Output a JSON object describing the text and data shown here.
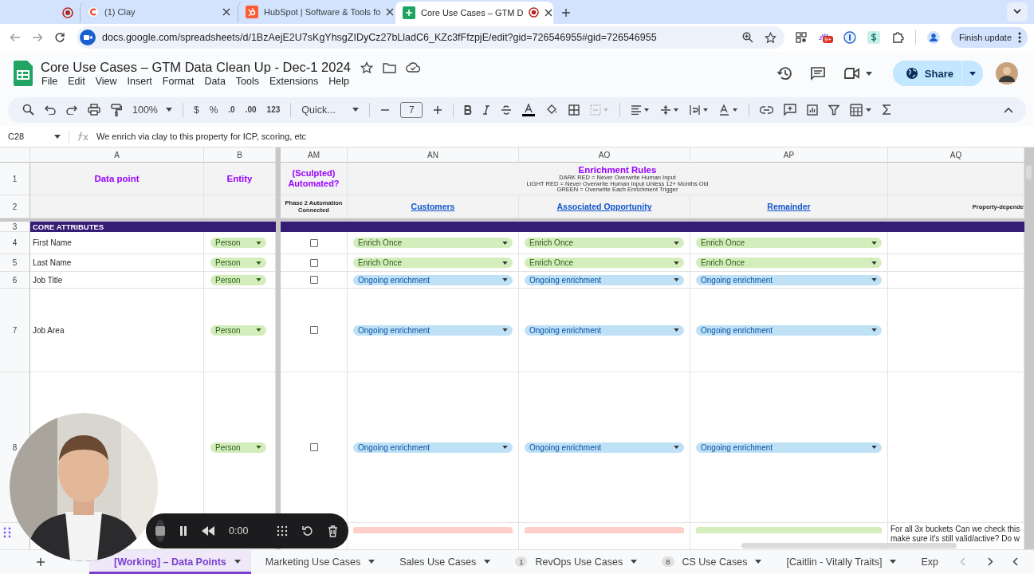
{
  "browser": {
    "tabs": [
      {
        "kind": "pinned",
        "selected": false
      },
      {
        "kind": "clay",
        "title": "(1) Clay",
        "selected": false
      },
      {
        "kind": "hubspot",
        "title": "HubSpot | Software & Tools fo",
        "selected": false
      },
      {
        "kind": "sheets",
        "title": "Core Use Cases – GTM D",
        "selected": true
      }
    ],
    "url": "docs.google.com/spreadsheets/d/1BzAejE2U7sKgYhsgZIDyCz27bLladC6_KZc3fFfzpjE/edit?gid=726546955#gid=726546955",
    "extension_badge": "9+",
    "finish_update": "Finish update"
  },
  "doc": {
    "title": "Core Use Cases – GTM Data Clean Up - Dec-1 2024",
    "menus": [
      "File",
      "Edit",
      "View",
      "Insert",
      "Format",
      "Data",
      "Tools",
      "Extensions",
      "Help"
    ],
    "share": "Share"
  },
  "toolbar": {
    "zoom": "100%",
    "currency": "$",
    "percent": "%",
    "decrease_decimal": ".0",
    "increase_decimal": ".00",
    "number_format": "123",
    "font": "Quick...",
    "font_size": "7"
  },
  "formula_bar": {
    "cell": "C28",
    "formula": "We enrich via clay to this property for ICP, scoring, etc"
  },
  "sheet": {
    "columns": [
      "A",
      "B",
      "AM",
      "AN",
      "AO",
      "AP",
      "AQ"
    ],
    "header_row": {
      "number": "1",
      "a": "Data point",
      "b": "Entity",
      "am": "(Sculpted) Automated?",
      "rules_title": "Enrichment Rules",
      "rules_lines": [
        "DARK RED = Never Overwrite Human Input",
        "LIGHT RED = Never Overwrite Human Input Unless 12+ Months Old",
        "GREEN = Overwrite Each Enrichment Trigger"
      ]
    },
    "sub_header_row": {
      "number": "2",
      "am": "Phase 2 Automation Connected",
      "links": [
        "Customers",
        "Associated Opportunity",
        "Remainder"
      ],
      "aq": "Property-depende"
    },
    "section_row": {
      "number": "3",
      "label": "CORE ATTRIBUTES"
    },
    "rows": [
      {
        "number": "4",
        "name": "First Name",
        "entity": {
          "label": "Person",
          "color": "#d4edbc"
        },
        "checked": false,
        "chips": [
          {
            "label": "Enrich Once",
            "color": "#d4edbc"
          },
          {
            "label": "Enrich Once",
            "color": "#d4edbc"
          },
          {
            "label": "Enrich Once",
            "color": "#d4edbc"
          }
        ]
      },
      {
        "number": "5",
        "name": "Last Name",
        "entity": {
          "label": "Person",
          "color": "#d4edbc"
        },
        "checked": false,
        "chips": [
          {
            "label": "Enrich Once",
            "color": "#d4edbc"
          },
          {
            "label": "Enrich Once",
            "color": "#d4edbc"
          },
          {
            "label": "Enrich Once",
            "color": "#d4edbc"
          }
        ]
      },
      {
        "number": "6",
        "name": "Job Title",
        "entity": {
          "label": "Person",
          "color": "#d4edbc"
        },
        "checked": false,
        "chips": [
          {
            "label": "Ongoing enrichment",
            "color": "#bfe1f6"
          },
          {
            "label": "Ongoing enrichment",
            "color": "#bfe1f6"
          },
          {
            "label": "Ongoing enrichment",
            "color": "#bfe1f6"
          }
        ]
      },
      {
        "number": "7",
        "name": "Job Area",
        "entity": {
          "label": "Person",
          "color": "#d4edbc"
        },
        "checked": false,
        "chips": [
          {
            "label": "Ongoing enrichment",
            "color": "#bfe1f6"
          },
          {
            "label": "Ongoing enrichment",
            "color": "#bfe1f6"
          },
          {
            "label": "Ongoing enrichment",
            "color": "#bfe1f6"
          }
        ]
      },
      {
        "number": "8",
        "entity": {
          "label": "Person",
          "color": "#d4edbc"
        },
        "checked": false,
        "chips": [
          {
            "label": "Ongoing enrichment",
            "color": "#bfe1f6"
          },
          {
            "label": "Ongoing enrichment",
            "color": "#bfe1f6"
          },
          {
            "label": "Ongoing enrichment",
            "color": "#bfe1f6"
          }
        ]
      }
    ],
    "partial_row": {
      "chips": [
        {
          "color": "#ffcfc9"
        },
        {
          "color": "#ffcfc9"
        },
        {
          "color": "#d4edbc"
        }
      ],
      "aq": "For all 3x buckets Can we check this make sure it's still valid/active? Do w"
    }
  },
  "sheet_tabs": [
    {
      "label": "[Working] – Data Points",
      "selected": true
    },
    {
      "label": "Marketing Use Cases",
      "selected": false
    },
    {
      "label": "Sales Use Cases",
      "selected": false
    },
    {
      "label": "RevOps Use Cases",
      "badge": "1",
      "selected": false
    },
    {
      "label": "CS Use Cases",
      "badge": "8",
      "selected": false
    },
    {
      "label": "[Caitlin - Vitally Traits]",
      "selected": false
    },
    {
      "label": "Exp",
      "selected": false
    }
  ],
  "recorder": {
    "time": "0:00"
  }
}
